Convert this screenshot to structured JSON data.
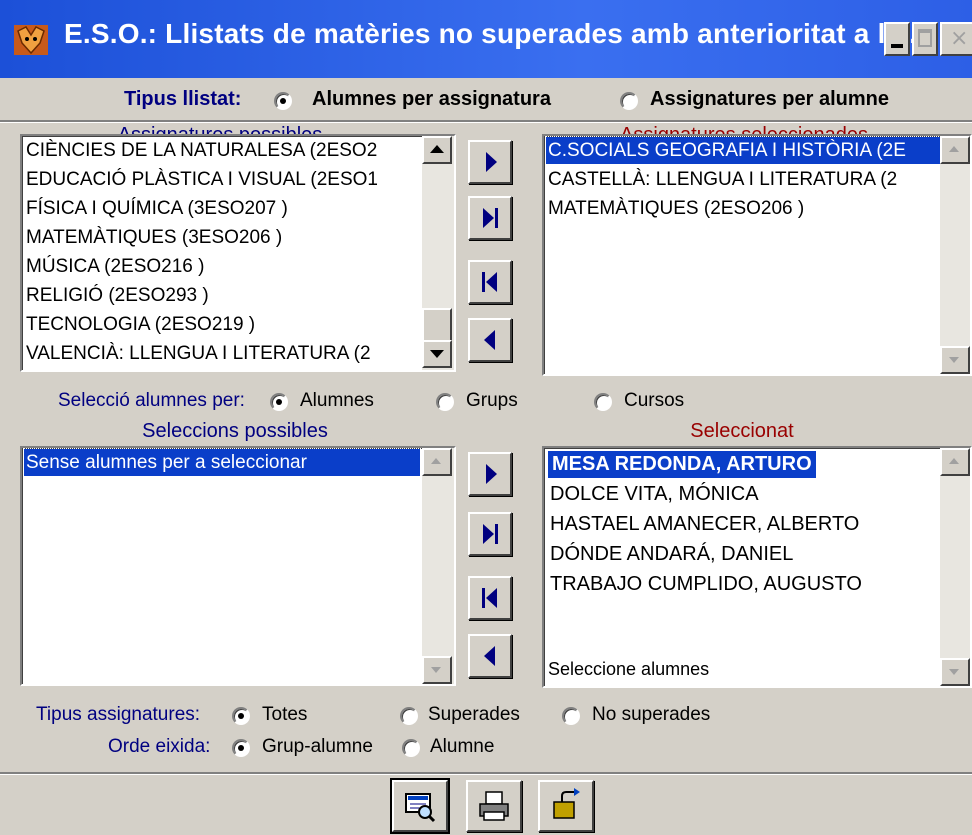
{
  "window": {
    "title": "E.S.O.: Llistats de matèries no superades amb anterioritat a la ...",
    "titlebar_color": "#2d5fe6",
    "icons": [
      "app-icon",
      "minimize-icon",
      "maximize-icon",
      "close-icon"
    ]
  },
  "list_type": {
    "label": "Tipus llistat:",
    "options": [
      {
        "label": "Alumnes per assignatura",
        "selected": true
      },
      {
        "label": "Assignatures per alumne",
        "selected": false
      }
    ]
  },
  "subjects": {
    "available_header": "Assignatures possibles",
    "available": [
      "CIÈNCIES DE LA NATURALESA (2ESO2",
      "EDUCACIÓ PLÀSTICA I VISUAL (2ESO1",
      "FÍSICA I QUÍMICA (3ESO207 )",
      "MATEMÀTIQUES (3ESO206 )",
      "MÚSICA (2ESO216 )",
      "RELIGIÓ (2ESO293 )",
      "TECNOLOGIA (2ESO219 )",
      "VALENCIÀ: LLENGUA I LITERATURA (2"
    ],
    "selected_header": "Assignatures seleccionades",
    "selected": [
      "C.SOCIALS GEOGRAFIA I HISTÒRIA (2E",
      "CASTELLÀ: LLENGUA I LITERATURA (2",
      "MATEMÀTIQUES (2ESO206 )"
    ]
  },
  "student_selection": {
    "label": "Selecció alumnes per:",
    "options": [
      {
        "label": "Alumnes",
        "selected": true
      },
      {
        "label": "Grups",
        "selected": false
      },
      {
        "label": "Cursos",
        "selected": false
      }
    ],
    "possible_header": "Seleccions possibles",
    "possible": [
      "Sense alumnes per a seleccionar"
    ],
    "selected_header": "Seleccionat",
    "selected": [
      "MESA REDONDA, ARTURO",
      "DOLCE VITA, MÓNICA",
      "HASTAEL AMANECER, ALBERTO",
      "DÓNDE ANDARÁ, DANIEL",
      "TRABAJO CUMPLIDO, AUGUSTO"
    ],
    "status": "Seleccione alumnes"
  },
  "subject_type": {
    "label": "Tipus assignatures:",
    "options": [
      {
        "label": "Totes",
        "selected": true
      },
      {
        "label": "Superades",
        "selected": false
      },
      {
        "label": "No superades",
        "selected": false
      }
    ]
  },
  "output_order": {
    "label": "Orde eixida:",
    "options": [
      {
        "label": "Grup-alumne",
        "selected": true
      },
      {
        "label": "Alumne",
        "selected": false
      }
    ]
  },
  "colors": {
    "header_blue": "#000080",
    "header_red": "#990000",
    "selection": "#0a3ec9",
    "face": "#d4d0c8"
  },
  "toolbar_icons": [
    "preview-icon",
    "print-icon",
    "exit-icon"
  ]
}
